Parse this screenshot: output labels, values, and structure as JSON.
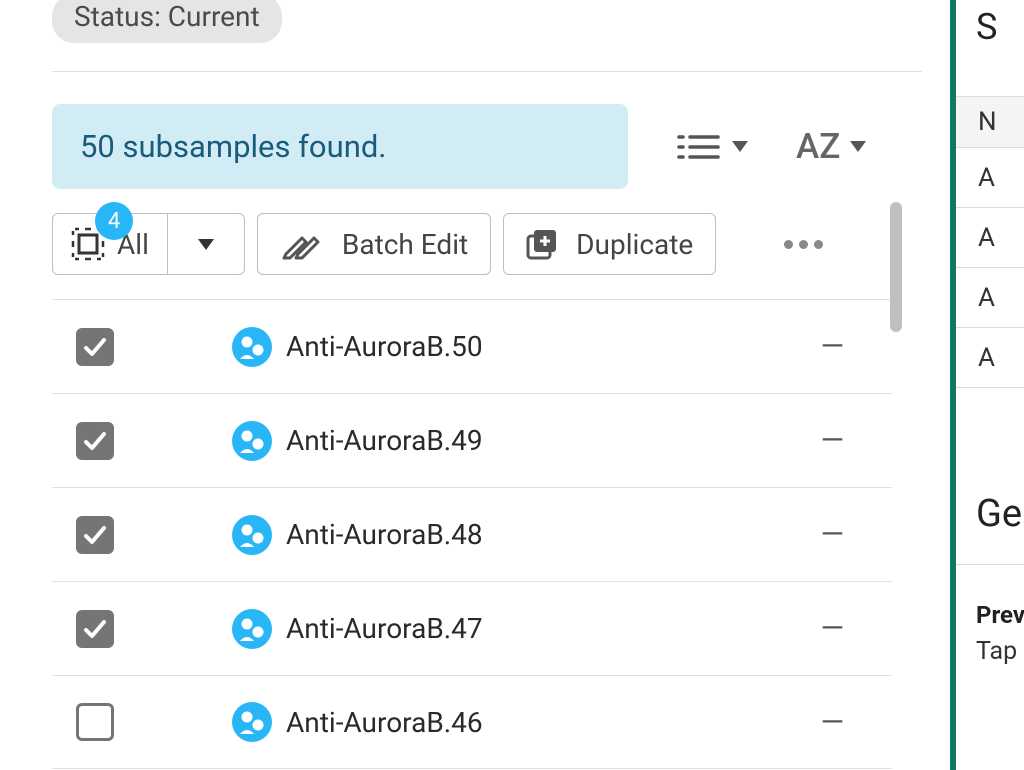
{
  "status_chip": "Status: Current",
  "results_banner": "50 subsamples found.",
  "sort_label": "AZ",
  "toolbar": {
    "select_all_label": "All",
    "selected_count": "4",
    "batch_edit_label": "Batch Edit",
    "duplicate_label": "Duplicate"
  },
  "items": [
    {
      "name": "Anti-AuroraB.50",
      "value": "—",
      "checked": true
    },
    {
      "name": "Anti-AuroraB.49",
      "value": "—",
      "checked": true
    },
    {
      "name": "Anti-AuroraB.48",
      "value": "—",
      "checked": true
    },
    {
      "name": "Anti-AuroraB.47",
      "value": "—",
      "checked": true
    },
    {
      "name": "Anti-AuroraB.46",
      "value": "—",
      "checked": false
    }
  ],
  "side": {
    "heading": "S",
    "th": "N",
    "rows": [
      "A",
      "A",
      "A",
      "A"
    ],
    "section_title": "Ge",
    "prev_label": "Prev",
    "tap_label": "Tap"
  }
}
